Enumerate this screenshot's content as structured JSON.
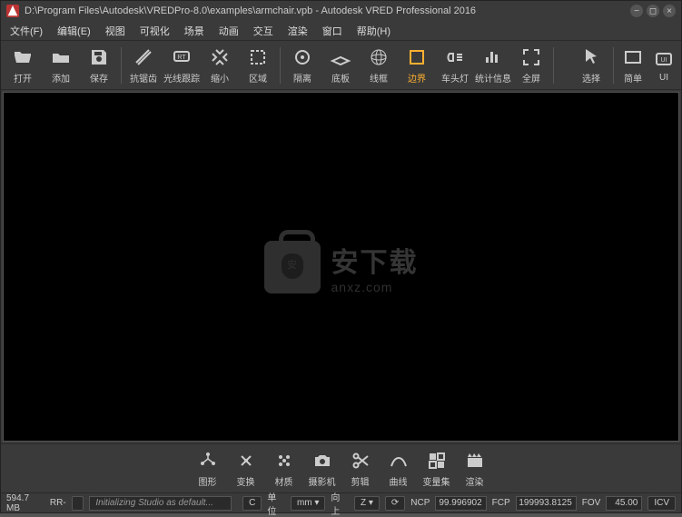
{
  "title": "D:\\Program Files\\Autodesk\\VREDPro-8.0\\examples\\armchair.vpb - Autodesk VRED Professional 2016",
  "menu": [
    "文件(F)",
    "编辑(E)",
    "视图",
    "可视化",
    "场景",
    "动画",
    "交互",
    "渲染",
    "窗口",
    "帮助(H)"
  ],
  "toolbar": [
    {
      "name": "open",
      "label": "打开"
    },
    {
      "name": "add",
      "label": "添加"
    },
    {
      "name": "save",
      "label": "保存"
    },
    {
      "name": "antialias",
      "label": "抗锯齿"
    },
    {
      "name": "raytrace",
      "label": "光线跟踪"
    },
    {
      "name": "shrink",
      "label": "缩小"
    },
    {
      "name": "region",
      "label": "区域"
    },
    {
      "name": "isolate",
      "label": "隔离"
    },
    {
      "name": "floor",
      "label": "底板"
    },
    {
      "name": "wireframe",
      "label": "线框"
    },
    {
      "name": "boundary",
      "label": "边界",
      "active": true
    },
    {
      "name": "headlight",
      "label": "车头灯"
    },
    {
      "name": "stats",
      "label": "统计信息"
    },
    {
      "name": "fullscreen",
      "label": "全屏"
    },
    {
      "name": "select",
      "label": "选择"
    },
    {
      "name": "simple",
      "label": "简单"
    },
    {
      "name": "ui",
      "label": "UI"
    }
  ],
  "bottom": [
    {
      "name": "scenegraph",
      "label": "图形"
    },
    {
      "name": "transform",
      "label": "变换"
    },
    {
      "name": "material",
      "label": "材质"
    },
    {
      "name": "camera",
      "label": "摄影机"
    },
    {
      "name": "clip",
      "label": "剪辑"
    },
    {
      "name": "curves",
      "label": "曲线"
    },
    {
      "name": "variants",
      "label": "变量集"
    },
    {
      "name": "render",
      "label": "渲染"
    }
  ],
  "status": {
    "memory": "594.7 MB",
    "rr": "RR-",
    "init": "Initializing Studio as default...",
    "c": "C",
    "unit_label": "单位",
    "unit_value": "mm",
    "up_label": "向上",
    "up_value": "Z",
    "ncp_label": "NCP",
    "ncp_value": "99.996902",
    "fcp_label": "FCP",
    "fcp_value": "199993.8125",
    "fov_label": "FOV",
    "fov_value": "45.00",
    "icv": "ICV"
  },
  "watermark": {
    "big": "安下载",
    "small": "anxz.com"
  }
}
